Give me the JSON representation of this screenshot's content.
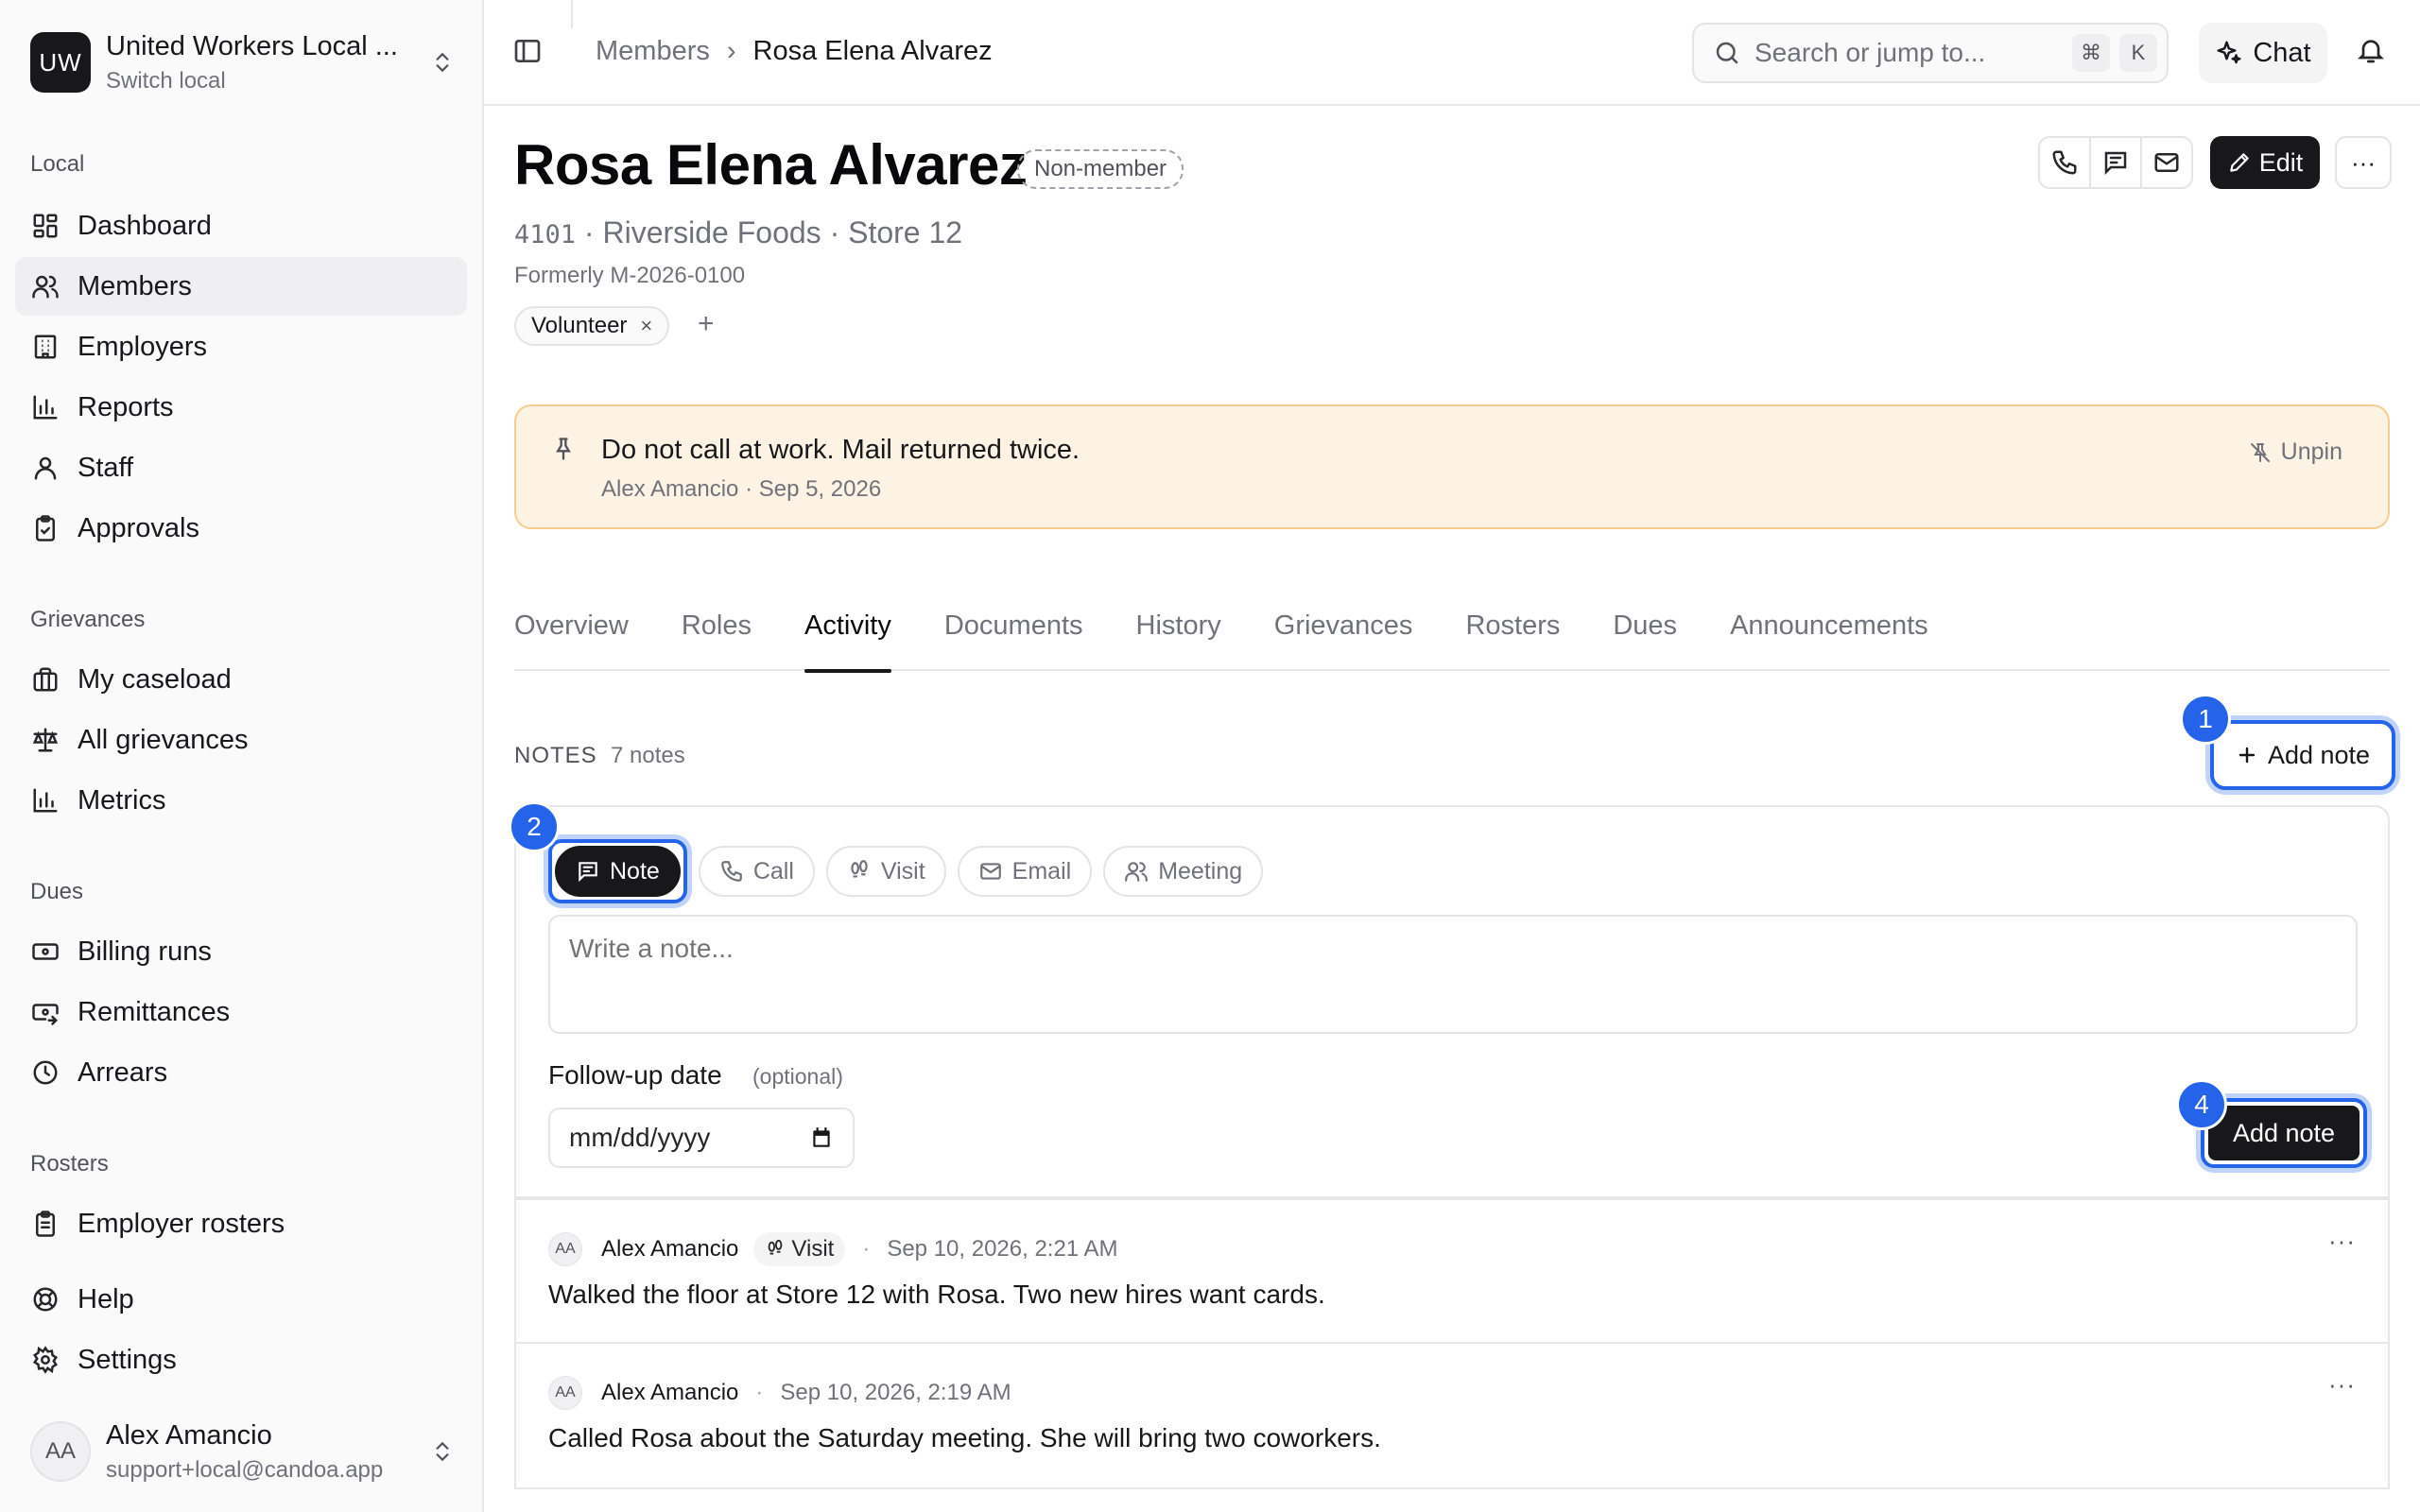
{
  "org": {
    "logo": "UW",
    "name": "United Workers Local ...",
    "subtitle": "Switch local"
  },
  "sidebar": {
    "sections": [
      {
        "label": "Local"
      },
      {
        "label": "Grievances"
      },
      {
        "label": "Dues"
      },
      {
        "label": "Rosters"
      }
    ],
    "items": [
      {
        "label": "Dashboard",
        "icon": "dashboard-icon"
      },
      {
        "label": "Members",
        "icon": "users-icon",
        "active": true
      },
      {
        "label": "Employers",
        "icon": "building-icon"
      },
      {
        "label": "Reports",
        "icon": "bar-chart-icon"
      },
      {
        "label": "Staff",
        "icon": "user-icon"
      },
      {
        "label": "Approvals",
        "icon": "clipboard-check-icon"
      },
      {
        "label": "My caseload",
        "icon": "briefcase-icon"
      },
      {
        "label": "All grievances",
        "icon": "scale-icon"
      },
      {
        "label": "Metrics",
        "icon": "bar-chart-icon"
      },
      {
        "label": "Billing runs",
        "icon": "banknote-icon"
      },
      {
        "label": "Remittances",
        "icon": "banknote-arrow-icon"
      },
      {
        "label": "Arrears",
        "icon": "clock-icon"
      },
      {
        "label": "Employer rosters",
        "icon": "clipboard-list-icon"
      },
      {
        "label": "Help",
        "icon": "lifebuoy-icon"
      },
      {
        "label": "Settings",
        "icon": "gear-icon"
      }
    ]
  },
  "user": {
    "initials": "AA",
    "name": "Alex Amancio",
    "email": "support+local@candoa.app"
  },
  "header": {
    "breadcrumb": {
      "parent": "Members",
      "separator": "›",
      "current": "Rosa Elena Alvarez"
    },
    "search": {
      "placeholder": "Search or jump to...",
      "kbd1": "⌘",
      "kbd2": "K"
    },
    "chat_label": "Chat"
  },
  "profile": {
    "name": "Rosa Elena Alvarez",
    "status_badge": "Non-member",
    "member_id": "4101",
    "employer_line": " · Riverside Foods · Store 12",
    "formerly": "Formerly M-2026-0100",
    "tags": [
      {
        "label": "Volunteer",
        "remove": "×"
      }
    ],
    "add_tag": "+",
    "edit_label": "Edit",
    "more": "···"
  },
  "pinned": {
    "text": "Do not call at work. Mail returned twice.",
    "meta": "Alex Amancio · Sep 5, 2026",
    "unpin_label": "Unpin"
  },
  "tabs": [
    {
      "label": "Overview"
    },
    {
      "label": "Roles"
    },
    {
      "label": "Activity",
      "active": true
    },
    {
      "label": "Documents"
    },
    {
      "label": "History"
    },
    {
      "label": "Grievances"
    },
    {
      "label": "Rosters"
    },
    {
      "label": "Dues"
    },
    {
      "label": "Announcements"
    }
  ],
  "notes": {
    "label": "NOTES",
    "count": "7 notes",
    "add_label": "Add note",
    "composer": {
      "types": [
        {
          "label": "Note",
          "icon": "message-square-icon",
          "selected": true
        },
        {
          "label": "Call",
          "icon": "phone-icon"
        },
        {
          "label": "Visit",
          "icon": "footprints-icon"
        },
        {
          "label": "Email",
          "icon": "mail-icon"
        },
        {
          "label": "Meeting",
          "icon": "users-icon"
        }
      ],
      "placeholder": "Write a note...",
      "followup_label": "Follow-up date",
      "followup_optional": "(optional)",
      "date_placeholder": "mm/dd/yyyy",
      "submit_label": "Add note"
    },
    "items": [
      {
        "initials": "AA",
        "author": "Alex Amancio",
        "kind": "Visit",
        "separator": "·",
        "time": "Sep 10, 2026, 2:21 AM",
        "body": "Walked the floor at Store 12 with Rosa. Two new hires want cards.",
        "more": "···"
      },
      {
        "initials": "AA",
        "author": "Alex Amancio",
        "separator": "·",
        "time": "Sep 10, 2026, 2:19 AM",
        "body": "Called Rosa about the Saturday meeting. She will bring two coworkers.",
        "more": "···"
      }
    ]
  },
  "markers": [
    "1",
    "2",
    "4"
  ],
  "colors": {
    "accent": "#2563eb",
    "pinned_bg": "#fdf3e4",
    "pinned_border": "#f6cd8c",
    "primary": "#18181b"
  }
}
